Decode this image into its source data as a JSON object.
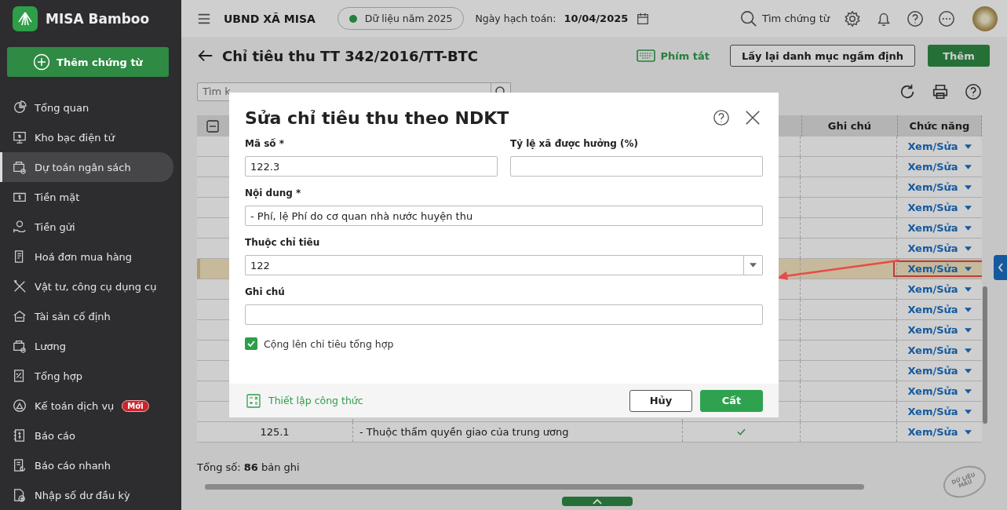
{
  "app": {
    "name": "MISA Bamboo",
    "new_voucher": "Thêm chứng từ"
  },
  "sidebar": {
    "items": [
      {
        "label": "Tổng quan",
        "selected": false
      },
      {
        "label": "Kho bạc điện tử",
        "selected": false
      },
      {
        "label": "Dự toán ngân sách",
        "selected": true
      },
      {
        "label": "Tiền mặt",
        "selected": false
      },
      {
        "label": "Tiền gửi",
        "selected": false
      },
      {
        "label": "Hoá đơn mua hàng",
        "selected": false
      },
      {
        "label": "Vật tư, công cụ dụng cụ",
        "selected": false
      },
      {
        "label": "Tài sản cố định",
        "selected": false
      },
      {
        "label": "Lương",
        "selected": false
      },
      {
        "label": "Tổng hợp",
        "selected": false
      },
      {
        "label": "Kế toán dịch vụ",
        "selected": false,
        "badge": "Mới"
      },
      {
        "label": "Báo cáo",
        "selected": false
      },
      {
        "label": "Báo cáo nhanh",
        "selected": false
      },
      {
        "label": "Nhập số dư đầu kỳ",
        "selected": false
      }
    ]
  },
  "topbar": {
    "unit": "UBND XÃ MISA",
    "data_year": "Dữ liệu năm 2025",
    "date_label": "Ngày hạch toán:",
    "date": "10/04/2025",
    "search": "Tìm chứng từ"
  },
  "page": {
    "title": "Chỉ tiêu thu TT 342/2016/TT-BTC",
    "shortcuts": "Phím tắt",
    "reset_button": "Lấy lại danh mục ngầm định",
    "add_button": "Thêm",
    "search_placeholder": "Tìm k"
  },
  "table": {
    "columns": [
      {},
      {},
      {},
      {
        "label": "Ghi chú"
      },
      {
        "label": "Chức năng"
      }
    ],
    "rows": [
      {
        "action": "Xem/Sửa",
        "selected": false
      },
      {
        "action": "Xem/Sửa",
        "selected": false
      },
      {
        "action": "Xem/Sửa",
        "selected": false
      },
      {
        "action": "Xem/Sửa",
        "selected": false
      },
      {
        "action": "Xem/Sửa",
        "selected": false
      },
      {
        "action": "Xem/Sửa",
        "selected": false
      },
      {
        "action": "Xem/Sửa",
        "selected": true,
        "annotated": true
      },
      {
        "action": "Xem/Sửa",
        "selected": false
      },
      {
        "action": "Xem/Sửa",
        "selected": false
      },
      {
        "action": "Xem/Sửa",
        "selected": false
      },
      {
        "action": "Xem/Sửa",
        "selected": false
      },
      {
        "action": "Xem/Sửa",
        "selected": false
      },
      {
        "action": "Xem/Sửa",
        "selected": false
      },
      {
        "action": "Xem/Sửa",
        "selected": false
      },
      {
        "code": "125.1",
        "content": "- Thuộc thẩm quyền giao của trung ương",
        "checked": true,
        "action": "Xem/Sửa",
        "selected": false
      }
    ]
  },
  "footer": {
    "total_label": "Tổng số:",
    "total": "86",
    "total_unit": "bản ghi",
    "stamp": "DỮ LIỆU MẪU"
  },
  "dialog": {
    "title": "Sửa chỉ tiêu thu theo NDKT",
    "code": {
      "label": "Mã số *",
      "value": "122.3"
    },
    "ratio": {
      "label": "Tỷ lệ xã được hưởng (%)"
    },
    "content": {
      "label": "Nội dung *",
      "value": "- Phí, lệ Phí do cơ quan nhà nước huyện thu"
    },
    "parent": {
      "label": "Thuộc chỉ tiêu",
      "value": "122"
    },
    "note": {
      "label": "Ghi chú"
    },
    "sum_up": {
      "label": "Cộng lên chỉ tiêu tổng hợp",
      "checked": true
    },
    "formula_link": "Thiết lập công thức",
    "cancel": "Hủy",
    "save": "Cất"
  }
}
